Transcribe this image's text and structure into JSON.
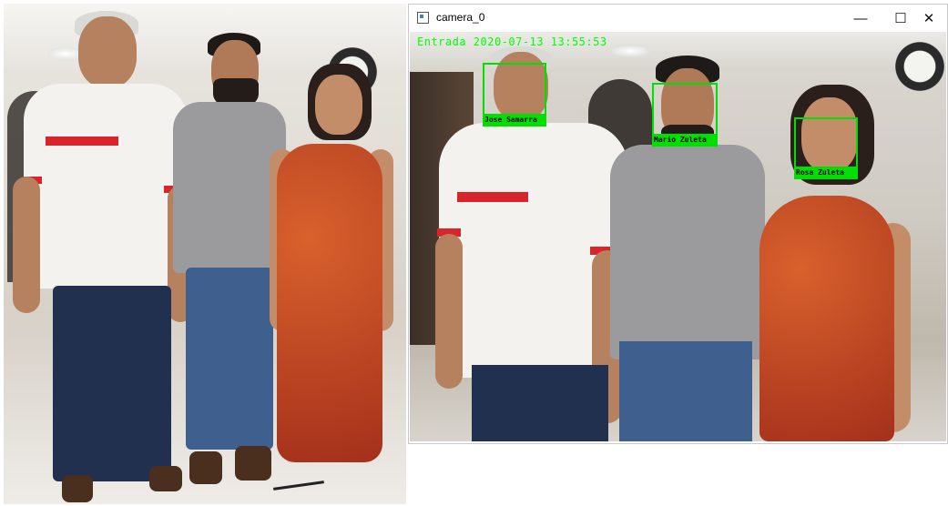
{
  "window": {
    "title": "camera_0",
    "buttons": {
      "minimize": "—",
      "maximize": "☐",
      "close": "✕"
    },
    "app_icon": "window-app-icon"
  },
  "overlay": {
    "timestamp_text": "Entrada 2020-07-13 13:55:53",
    "text_color": "#00ff00"
  },
  "detections": [
    {
      "name": "Jose Samarra",
      "box_color": "#00e000"
    },
    {
      "name": "Mario Zuleta",
      "box_color": "#00e000"
    },
    {
      "name": "Rosa Zuleta",
      "box_color": "#00e000"
    }
  ],
  "colors": {
    "box": "#00e000",
    "shirt_white": "#f4f2ee",
    "shirt_red": "#d8242b",
    "shirt_gray": "#9b9b9d",
    "dress": "#c2451f",
    "jeans": "#3f5f8f"
  }
}
